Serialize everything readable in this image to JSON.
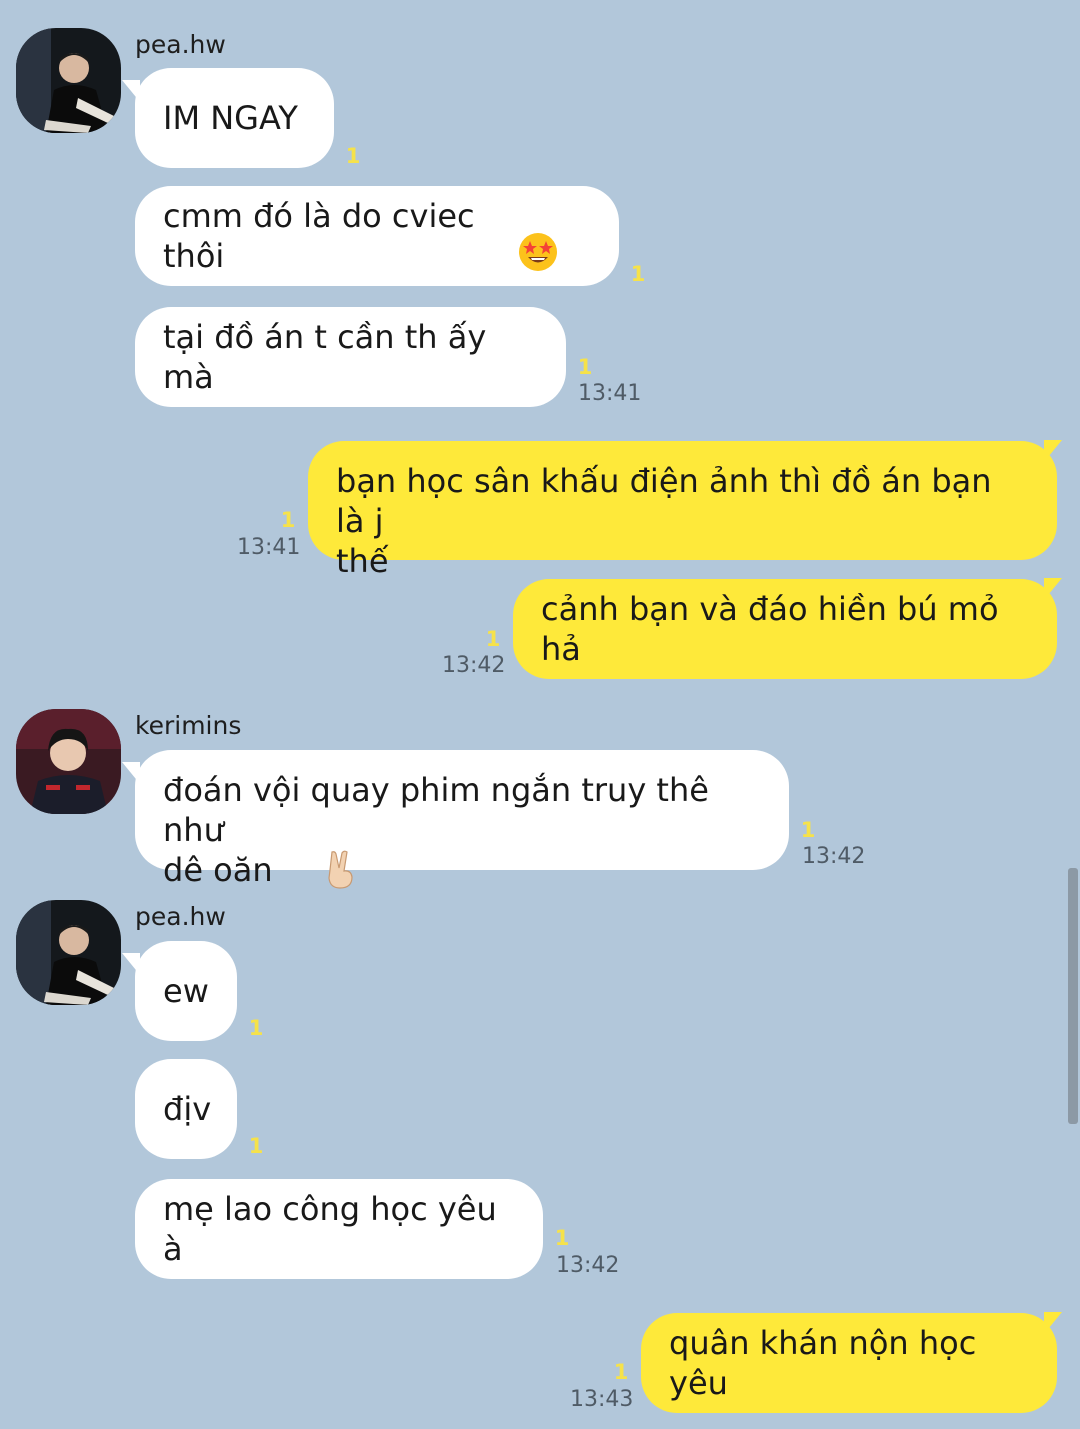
{
  "messages": [
    {
      "sender": "pea.hw",
      "text": "IM NGAY",
      "unread": "1",
      "time": ""
    },
    {
      "sender": "pea.hw",
      "text": "cmm đó là do cviec thôi",
      "emoji": "star-struck-emoji",
      "unread": "1",
      "time": ""
    },
    {
      "sender": "pea.hw",
      "text": "tại đồ án t cần th ấy mà",
      "unread": "1",
      "time": "13:41"
    },
    {
      "sender": "me",
      "text": "bạn học sân khấu điện ảnh thì đồ án bạn là j\nthế",
      "unread": "1",
      "time": "13:41"
    },
    {
      "sender": "me",
      "text": "cảnh bạn và đáo hiền bú mỏ hả",
      "unread": "1",
      "time": "13:42"
    },
    {
      "sender": "kerimins",
      "text": "đoán vội quay phim ngắn truy thê như\ndê oăn",
      "emoji": "victory-hand-emoji",
      "unread": "1",
      "time": "13:42"
    },
    {
      "sender": "pea.hw",
      "text": "ew",
      "unread": "1",
      "time": ""
    },
    {
      "sender": "pea.hw",
      "text": "địv",
      "unread": "1",
      "time": ""
    },
    {
      "sender": "pea.hw",
      "text": "mẹ lao công học yêu à",
      "unread": "1",
      "time": "13:42"
    },
    {
      "sender": "me",
      "text": "quân khán nộn học yêu",
      "unread": "1",
      "time": "13:43"
    }
  ],
  "groups": [
    {
      "name": "pea.hw"
    },
    {
      "name": "kerimins"
    },
    {
      "name": "pea.hw"
    }
  ],
  "colors": {
    "background": "#b2c7da",
    "incoming_bubble": "#ffffff",
    "outgoing_bubble": "#fee93a",
    "unread_count": "#f6e24a",
    "timestamp": "#4f5b66"
  }
}
